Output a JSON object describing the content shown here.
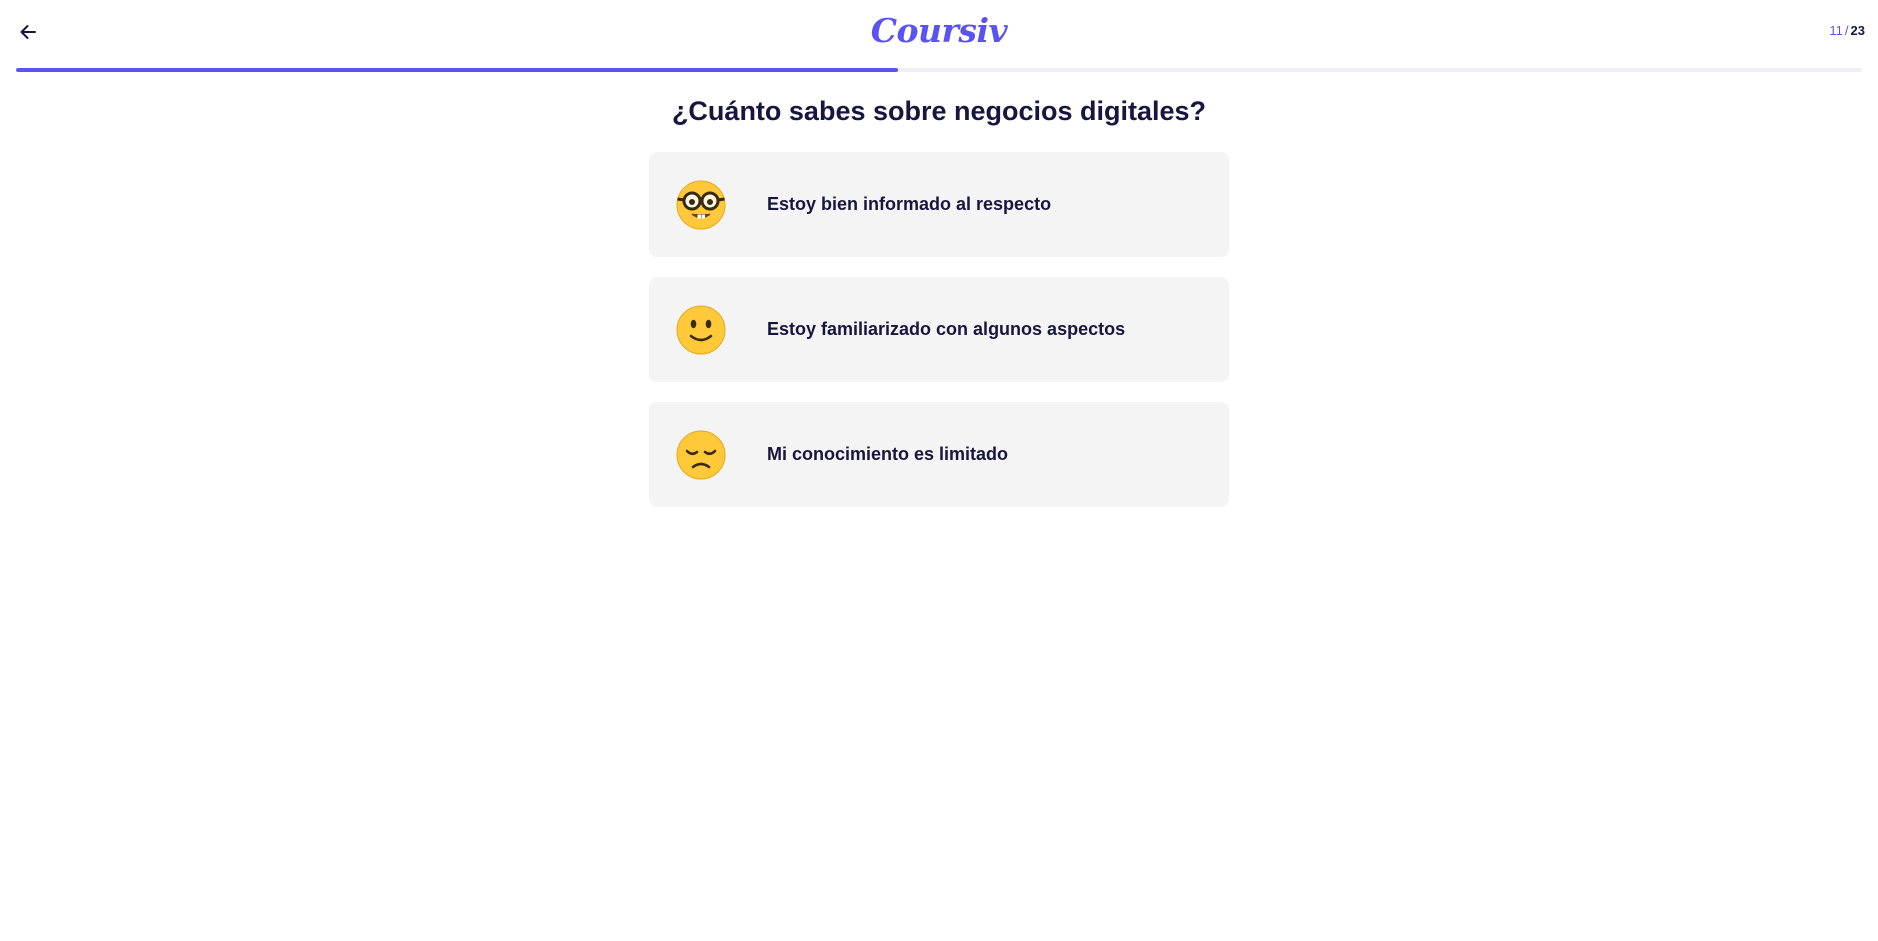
{
  "header": {
    "back_icon": "arrow-left-icon",
    "logo_text": "Coursiv",
    "step": {
      "current": "11",
      "separator": "/",
      "total": "23"
    }
  },
  "progress": {
    "fraction": 0.478
  },
  "colors": {
    "accent": "#5b53f1",
    "text": "#16163f",
    "card_bg": "#f4f4f4",
    "emoji_yellow": "#ffc93a"
  },
  "question": "¿Cuánto sabes sobre negocios digitales?",
  "options": [
    {
      "icon": "nerd-face-emoji-icon",
      "label": "Estoy bien informado al respecto"
    },
    {
      "icon": "slightly-smiling-face-emoji-icon",
      "label": "Estoy familiarizado con algunos aspectos"
    },
    {
      "icon": "disappointed-face-emoji-icon",
      "label": "Mi conocimiento es limitado"
    }
  ]
}
